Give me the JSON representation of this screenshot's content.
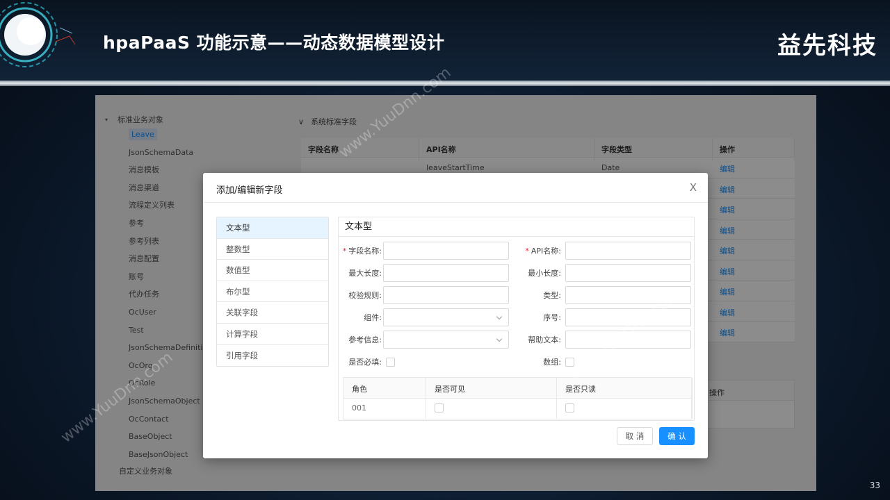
{
  "slide": {
    "title": "hpaPaaS 功能示意——动态数据模型设计",
    "brand": "益先科技",
    "page_number": "33",
    "watermark": "www.YuuDnn.com"
  },
  "tree": {
    "root_label": "标准业务对象",
    "items": [
      "Leave",
      "JsonSchemaData",
      "消息模板",
      "消息渠道",
      "流程定义列表",
      "参考",
      "参考列表",
      "消息配置",
      "账号",
      "代办任务",
      "OcUser",
      "Test",
      "JsonSchemaDefinition",
      "OcOrg",
      "OcRole",
      "JsonSchemaObject",
      "OcContact",
      "BaseObject",
      "BaseJsonObject"
    ],
    "custom_root_label": "自定义业务对象"
  },
  "background_table": {
    "section_title": "系统标准字段",
    "headers": [
      "字段名称",
      "API名称",
      "字段类型",
      "操作"
    ],
    "first_row": {
      "api": "leaveStartTime",
      "type": "Date"
    },
    "action_label": "编辑",
    "table2_header": "操作"
  },
  "modal": {
    "title": "添加/编辑新字段",
    "close_label": "X",
    "types": [
      "文本型",
      "整数型",
      "数值型",
      "布尔型",
      "关联字段",
      "计算字段",
      "引用字段"
    ],
    "panel_title": "文本型",
    "labels": {
      "field_name": "字段名称:",
      "api_name": "API名称:",
      "max_length": "最大长度:",
      "min_length": "最小长度:",
      "validation": "校验规则:",
      "kind": "类型:",
      "component": "组件:",
      "order": "序号:",
      "reference": "参考信息:",
      "help_text": "帮助文本:",
      "required": "是否必填:",
      "array": "数组:"
    },
    "perm_table": {
      "headers": [
        "角色",
        "是否可见",
        "是否只读"
      ],
      "rows": [
        {
          "role": "001"
        }
      ]
    },
    "cancel_label": "取 消",
    "ok_label": "确 认"
  }
}
